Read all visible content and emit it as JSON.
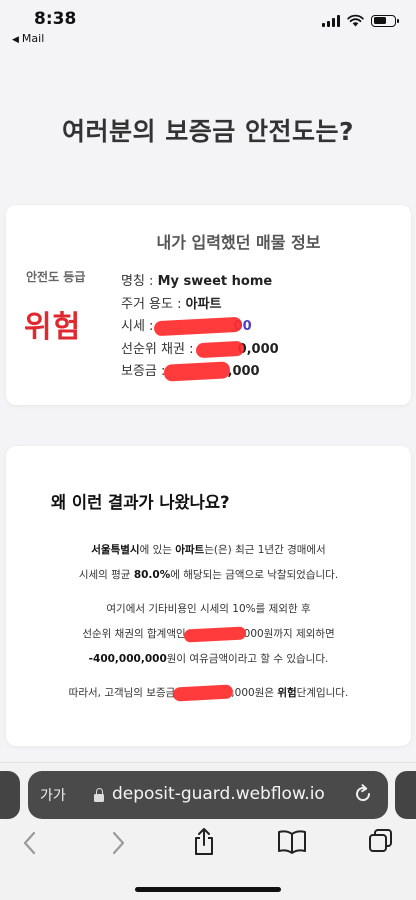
{
  "status_bar": {
    "time": "8:38",
    "back_app": "Mail",
    "back_icon": "back-triangle-icon",
    "battery_level": 0.6
  },
  "page": {
    "title": "여러분의 보증금 안전도는?"
  },
  "property_card": {
    "heading": "내가 입력했던 매물 정보",
    "grade_label": "안전도 등급",
    "grade_value": "위험",
    "grade_color": "#e0282f",
    "name_label": "명칭 : ",
    "name_value": "My sweet home",
    "usage_label": "주거 용도 : ",
    "usage_value": "아파트",
    "price_label": "시세 : ",
    "price_tail": "00",
    "senior_label": "선순위 채권 : ",
    "senior_tail": "0,000",
    "deposit_label": "보증금 : ",
    "deposit_tail": ",000",
    "redaction_color": "#ff2a2a"
  },
  "reason_card": {
    "heading": "왜 이런 결과가 나왔나요?",
    "p1_region": "서울특별시",
    "p1_a": "에 있는 ",
    "p1_type": "아파트",
    "p1_b": "는(은) 최근 1년간 경매에서",
    "p1_c": "시세의 평균 ",
    "p1_rate": "80.0%",
    "p1_d": "에 해당되는 금액으로 낙찰되었습니다.",
    "p2_a": "여기에서 기타비용인 시세의 10%를 제외한 후",
    "p2_b": "선순위 채권의 합계액인",
    "p2_c": "000원까지 제외하면",
    "p2_amount": "-400,000,000",
    "p2_d": "원이 여유금액이라고 할 수 있습니다.",
    "p3_a": "따라서, 고객님의 보증금",
    "p3_b": ",000원은 ",
    "p3_grade": "위험",
    "p3_c": "단계입니다."
  },
  "browser": {
    "text_size_label": "가가",
    "url": "deposit-guard.webflow.io",
    "icons": [
      "lock-icon",
      "reload-icon",
      "back-arrow-icon",
      "forward-arrow-icon",
      "share-icon",
      "bookmarks-icon",
      "tabs-icon"
    ]
  }
}
